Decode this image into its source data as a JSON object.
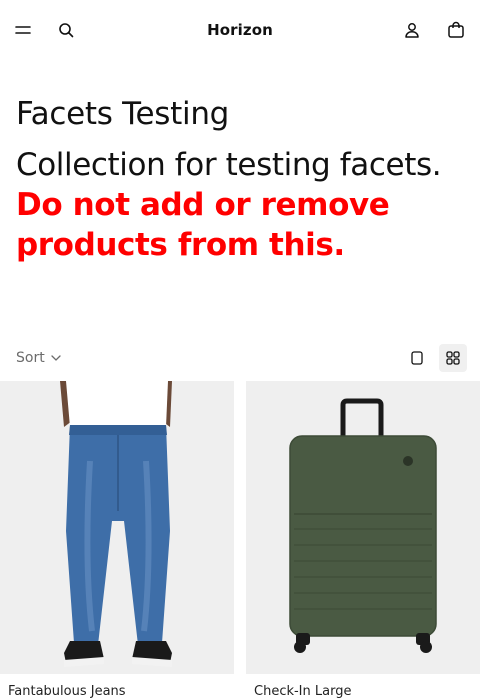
{
  "header": {
    "brand": "Horizon",
    "icons": {
      "menu": "menu-icon",
      "search": "search-icon",
      "account": "account-icon",
      "cart": "cart-icon"
    }
  },
  "collection": {
    "title": "Facets Testing",
    "description_plain": "Collection for testing facets.",
    "description_warning": "Do not add or remove products from this."
  },
  "toolbar": {
    "sort_label": "Sort",
    "views": [
      "single-column-view-icon",
      "grid-view-icon"
    ],
    "active_view": "grid"
  },
  "products": [
    {
      "name": "Fantabulous Jeans",
      "image": "jeans-photo"
    },
    {
      "name": "Check-In Large",
      "image": "suitcase-photo"
    }
  ],
  "colors": {
    "warning": "#ff0000",
    "text": "#111111",
    "muted": "#6b6b6b",
    "image_bg": "#efefef",
    "suitcase": "#4a5a43"
  }
}
